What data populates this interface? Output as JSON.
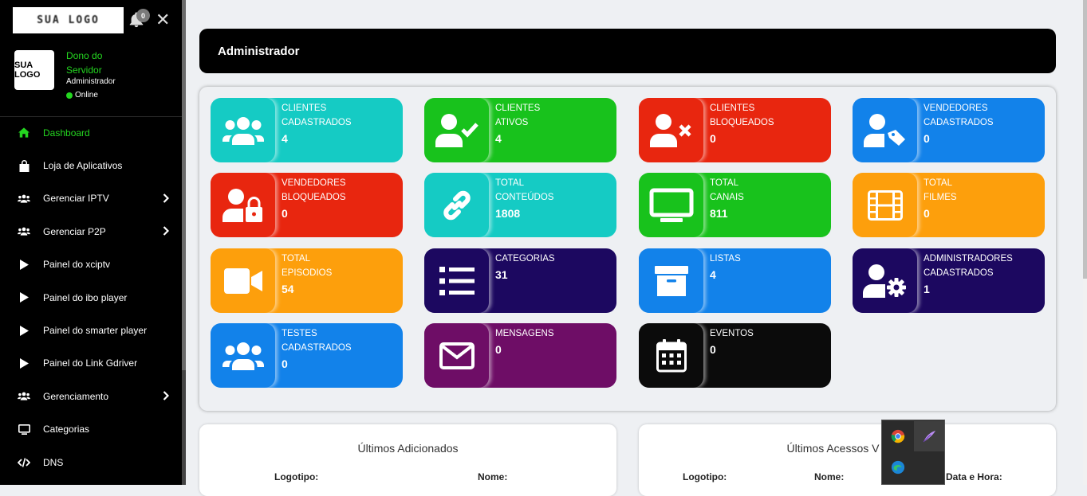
{
  "sidebar": {
    "logo_text": "SUA LOGO",
    "notifications_count": "0",
    "avatar_text": "SUA LOGO",
    "user_name": "Dono do Servidor",
    "user_role": "Administrador",
    "user_status": "Online",
    "items": [
      {
        "label": "Dashboard",
        "icon": "home-icon",
        "active": true,
        "submenu": false
      },
      {
        "label": "Loja de Aplicativos",
        "icon": "bag-icon",
        "active": false,
        "submenu": false
      },
      {
        "label": "Gerenciar IPTV",
        "icon": "users-icon",
        "active": false,
        "submenu": true
      },
      {
        "label": "Gerenciar P2P",
        "icon": "users-icon",
        "active": false,
        "submenu": true
      },
      {
        "label": "Painel do xciptv",
        "icon": "play-icon",
        "active": false,
        "submenu": false
      },
      {
        "label": "Painel do ibo player",
        "icon": "play-icon",
        "active": false,
        "submenu": false
      },
      {
        "label": "Painel do smarter player",
        "icon": "play-icon",
        "active": false,
        "submenu": false
      },
      {
        "label": "Painel do Link Gdriver",
        "icon": "play-icon",
        "active": false,
        "submenu": false
      },
      {
        "label": "Gerenciamento",
        "icon": "users-icon",
        "active": false,
        "submenu": true
      },
      {
        "label": "Categorias",
        "icon": "monitor-icon",
        "active": false,
        "submenu": false
      },
      {
        "label": "DNS",
        "icon": "code-icon",
        "active": false,
        "submenu": false
      }
    ]
  },
  "header": {
    "title": "Administrador"
  },
  "cards": [
    {
      "label": "Clientes\nCadastrados",
      "value": "4",
      "color": "#15cbc4",
      "icon": "users-group-icon"
    },
    {
      "label": "Clientes\nAtivos",
      "value": "4",
      "color": "#18c21c",
      "icon": "user-check-icon"
    },
    {
      "label": "Clientes\nBloqueados",
      "value": "0",
      "color": "#e8260f",
      "icon": "user-times-icon"
    },
    {
      "label": "Vendedores\nCadastrados",
      "value": "0",
      "color": "#1282ea",
      "icon": "user-tag-icon"
    },
    {
      "label": "Vendedores\nBloqueados",
      "value": "0",
      "color": "#e8260f",
      "icon": "user-lock-icon"
    },
    {
      "label": "Total\nConteúdos",
      "value": "1808",
      "color": "#15cbc4",
      "icon": "link-icon"
    },
    {
      "label": "Total\nCanais",
      "value": "811",
      "color": "#18c21c",
      "icon": "tv-icon"
    },
    {
      "label": "Total\nFilmes",
      "value": "0",
      "color": "#fd9f0c",
      "icon": "film-icon"
    },
    {
      "label": "Total\nEpisodios",
      "value": "54",
      "color": "#fd9f0c",
      "icon": "video-icon"
    },
    {
      "label": "Categorias",
      "value": "31",
      "color": "#1c0860",
      "icon": "list-icon"
    },
    {
      "label": "Listas",
      "value": "4",
      "color": "#1282ea",
      "icon": "archive-icon"
    },
    {
      "label": "Administradores\nCadastrados",
      "value": "1",
      "color": "#1c0860",
      "icon": "user-cog-icon"
    },
    {
      "label": "Testes\nCadastrados",
      "value": "0",
      "color": "#1282ea",
      "icon": "users-group-icon"
    },
    {
      "label": "Mensagens",
      "value": "0",
      "color": "#6e0d66",
      "icon": "envelope-icon"
    },
    {
      "label": "Eventos",
      "value": "0",
      "color": "#0b0b0b",
      "icon": "calendar-icon"
    }
  ],
  "panels": [
    {
      "title": "Últimos Adicionados",
      "columns": [
        "Logotipo:",
        "Nome:"
      ]
    },
    {
      "title": "Últimos Acessos V",
      "columns": [
        "Logotipo:",
        "Nome:",
        "Data e Hora:"
      ]
    }
  ],
  "tray": {
    "apps": [
      "chrome-icon",
      "feather-app-icon",
      "edge-icon"
    ]
  }
}
